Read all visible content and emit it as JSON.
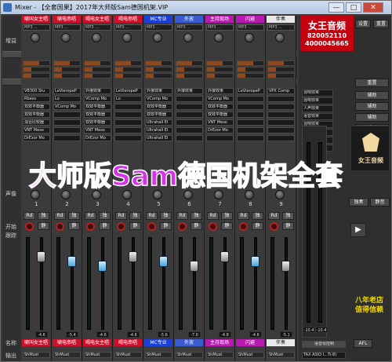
{
  "window": {
    "title": "Mixer - 【全套国果】2017年大师版Sam德国机架.VIP",
    "minimize": "—",
    "maximize": "□",
    "close": "✕"
  },
  "left_labels": {
    "gain": "增益",
    "aux": "辅助",
    "plugin": "插件",
    "pan": "声像",
    "open": "开始",
    "follow": "跟踪",
    "name": "名称",
    "output": "输出"
  },
  "channels": [
    {
      "name": "啸叫女主唱",
      "color": "#d0102b",
      "number": "1",
      "slots": [
        "VB300 Stu",
        "Rbass",
        "双效平衡器",
        "双效平衡器",
        "混合比较器",
        "VNT Meso",
        "DrEzor Mo"
      ],
      "level": "-4.6",
      "cap": "gray",
      "output": "ShMust",
      "sel": "MP3 ..."
    },
    {
      "name": "啸电串唱",
      "color": "#d0102b",
      "number": "2",
      "slots": [
        "LeVieropeP",
        "Lo",
        "VComp Mo",
        "",
        "",
        "",
        ""
      ],
      "level": "-5.4",
      "cap": "blue",
      "output": "ShMust",
      "sel": "MP3 ..."
    },
    {
      "name": "喝电女主唱",
      "color": "#d0102b",
      "number": "3",
      "slots": [
        "外接效果",
        "VComp Mo",
        "双效平衡器",
        "双效平衡器",
        "双效平衡器",
        "VNT Meso",
        "DrEzor Mo"
      ],
      "level": "-4.6",
      "cap": "blue",
      "output": "ShMust",
      "sel": "MP3 ..."
    },
    {
      "name": "喝电串唱",
      "color": "#d0102b",
      "number": "4",
      "slots": [
        "LeVieropeP",
        "Lo",
        "",
        "",
        "",
        "",
        ""
      ],
      "level": "-4.6",
      "cap": "gray",
      "output": "ShMust",
      "sel": "MP3 ..."
    },
    {
      "name": "MC专业",
      "color": "#1c3fd8",
      "number": "5",
      "slots": [
        "外接效果",
        "VComp Mo",
        "双效平衡器",
        "双效平衡器",
        "Ultrahall Ei",
        "Ultrahall Ei",
        "Ultrahall Ei"
      ],
      "level": "-5.6",
      "cap": "blue",
      "output": "ShMust",
      "sel": "MP3 ..."
    },
    {
      "name": "外放",
      "color": "#3a5ad0",
      "number": "6",
      "slots": [
        "外接效果",
        "",
        "",
        "",
        "",
        "",
        ""
      ],
      "level": "-7.0",
      "cap": "gray",
      "output": "ShMust",
      "sel": "MP3 ..."
    },
    {
      "name": "主持现场",
      "color": "#b81ab0",
      "number": "7",
      "slots": [
        "外接效果",
        "VComp Mo",
        "双效平衡器",
        "双效平衡器",
        "VNT Meso",
        "DrEzor Mo",
        ""
      ],
      "level": "-4.8",
      "cap": "gray",
      "output": "ShMust",
      "sel": "MP3 ..."
    },
    {
      "name": "闪避",
      "color": "#b81ab0",
      "number": "8",
      "slots": [
        "LeVieropeP",
        "",
        "",
        "",
        "",
        "",
        ""
      ],
      "level": "-4.6",
      "cap": "blue",
      "output": "ShMust",
      "sel": "MP3 ..."
    },
    {
      "name": "伴奏",
      "color": "#e8e8e8",
      "number": "9",
      "slots": [
        "VPX Comp",
        "",
        "",
        "",
        "",
        "",
        ""
      ],
      "level": "-5.1",
      "cap": "gray",
      "output": "ShMust",
      "sel": "MP3 ..."
    }
  ],
  "master": {
    "label": "主输出",
    "level_l": "-10.4",
    "level_r": "-10.4",
    "output": "TAX ASIO I...Ti-8)",
    "name": "语音母控制"
  },
  "brand": {
    "title": "女王音频",
    "phone1": "820052110",
    "phone2": "4000045665",
    "badge": "女王音频",
    "slogan1": "八年老店",
    "slogan2": "值得信赖"
  },
  "right_buttons": {
    "setup": "设置",
    "reset": "重置",
    "aux_items": [
      "混响效果",
      "混响效果",
      "人声效果",
      "语音效果",
      "混响效果",
      "混响效果",
      "延迟效果",
      "其他"
    ],
    "side": [
      "辅助",
      "辅助",
      "辅助",
      "辅助",
      "辅助"
    ],
    "play": "▶",
    "afl": "AFL",
    "mono": "独奏",
    "mute": "静音",
    "group": "语音处理"
  },
  "common": {
    "rd": "Rd",
    "solo": "独",
    "mute": "静",
    "aux": "辅助",
    "plugin": "插件"
  },
  "overlay": "大师版Sam德国机架全套"
}
